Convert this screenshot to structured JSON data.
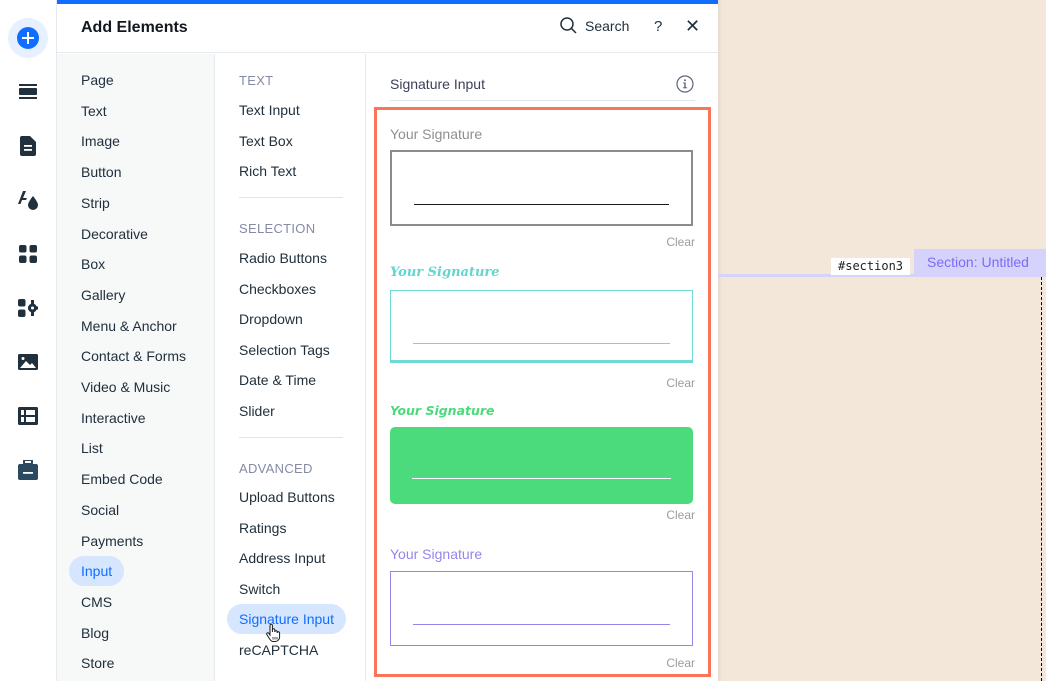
{
  "rail": {
    "items": [
      {
        "icon": "add-icon",
        "label": "Add Elements",
        "active": true
      },
      {
        "icon": "sections-icon",
        "label": "Sections"
      },
      {
        "icon": "pages-icon",
        "label": "Pages"
      },
      {
        "icon": "theme-icon",
        "label": "Site Design"
      },
      {
        "icon": "apps-icon",
        "label": "Apps"
      },
      {
        "icon": "business-apps-icon",
        "label": "Business Apps"
      },
      {
        "icon": "media-icon",
        "label": "Media"
      },
      {
        "icon": "cms-icon",
        "label": "CMS"
      },
      {
        "icon": "portfolio-icon",
        "label": "Portfolio"
      }
    ]
  },
  "panel": {
    "title": "Add Elements",
    "search_label": "Search",
    "help_label": "?",
    "close_label": "✕",
    "accent": "#116dff"
  },
  "categories": [
    "Page",
    "Text",
    "Image",
    "Button",
    "Strip",
    "Decorative",
    "Box",
    "Gallery",
    "Menu & Anchor",
    "Contact & Forms",
    "Video & Music",
    "Interactive",
    "List",
    "Embed Code",
    "Social",
    "Payments",
    "Input",
    "CMS",
    "Blog",
    "Store"
  ],
  "selected_category": "Input",
  "subcategories": {
    "groups": [
      {
        "heading": "TEXT",
        "items": [
          "Text Input",
          "Text Box",
          "Rich Text"
        ]
      },
      {
        "heading": "SELECTION",
        "items": [
          "Radio Buttons",
          "Checkboxes",
          "Dropdown",
          "Selection Tags",
          "Date & Time",
          "Slider"
        ]
      },
      {
        "heading": "ADVANCED",
        "items": [
          "Upload Buttons",
          "Ratings",
          "Address Input",
          "Switch",
          "Signature Input",
          "reCAPTCHA"
        ]
      }
    ],
    "selected": "Signature Input"
  },
  "preview": {
    "title": "Signature Input",
    "frame_color": "#f9745a",
    "variants": [
      {
        "label": "Your Signature",
        "clear": "Clear",
        "label_color": "#8f8f8f",
        "border_color": "#8c8c8c",
        "line_color": "#1a1a1a",
        "fill": "#ffffff"
      },
      {
        "label": "Your Signature",
        "clear": "Clear",
        "label_color": "#5fd6d2",
        "border_color": "#6fd9d5",
        "line_color": "#6fd9d5",
        "fill": "#ffffff"
      },
      {
        "label": "Your Signature",
        "clear": "Clear",
        "label_color": "#4cd97b",
        "border_color": "#4cdb7c",
        "line_color": "#ffffff",
        "fill": "#4cdb7c"
      },
      {
        "label": "Your Signature",
        "clear": "Clear",
        "label_color": "#9486ec",
        "border_color": "#9486ec",
        "line_color": "#9486ec",
        "fill": "#ffffff"
      }
    ]
  },
  "canvas": {
    "anchor_id": "#section3",
    "section_label": "Section: Untitled",
    "background": "#f3e7da"
  }
}
